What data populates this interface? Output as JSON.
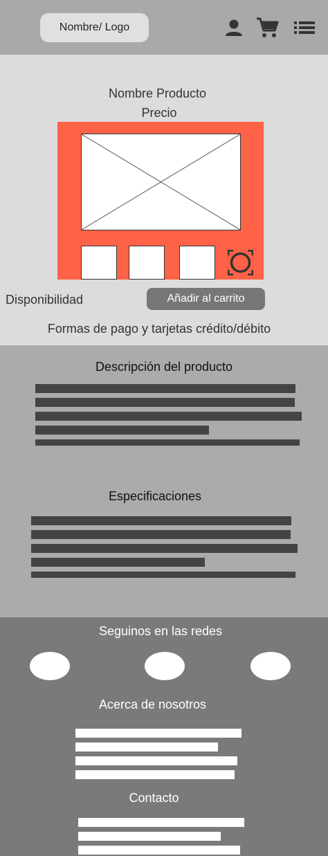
{
  "header": {
    "logo_label": "Nombre/ Logo",
    "icons": [
      "user-icon",
      "cart-icon",
      "menu-list-icon"
    ]
  },
  "product": {
    "name": "Nombre Producto",
    "price": "Precio",
    "availability": "Disponibilidad",
    "add_to_cart": "Añadir al carrito",
    "payment": "Formas de pago y tarjetas crédito/débito"
  },
  "sections": {
    "description_title": "Descripción del producto",
    "specs_title": "Especificaciones"
  },
  "footer": {
    "social_title": "Seguinos en las redes",
    "about_title": "Acerca de nosotros",
    "contact_title": "Contacto"
  },
  "colors": {
    "accent": "#ff6347",
    "header_bg": "#a9a9a9",
    "hero_bg": "#dcdcdc",
    "desc_bg": "#ababab",
    "footer_bg": "#7a7a7a"
  }
}
